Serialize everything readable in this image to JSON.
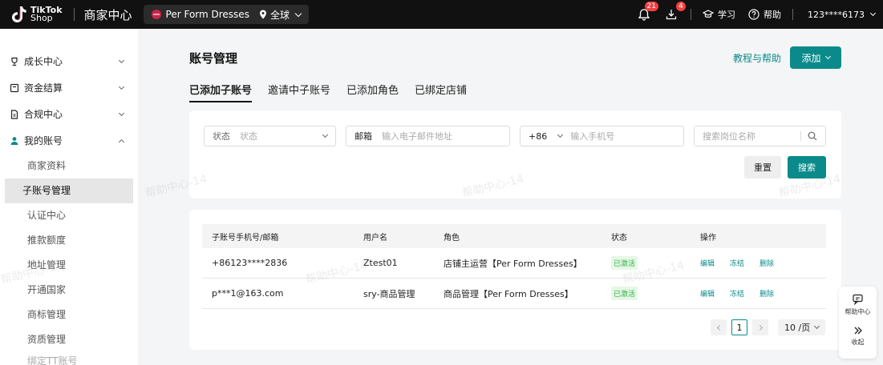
{
  "topbar": {
    "logo_line1": "TikTok",
    "logo_line2": "Shop",
    "title": "商家中心",
    "shop_name": "Per Form Dresses",
    "region": "全球",
    "notif_count": "21",
    "download_count": "4",
    "learn": "学习",
    "help": "帮助",
    "account": "123****6173"
  },
  "sidebar": {
    "groups": [
      {
        "label": "成长中心",
        "icon": "trophy-icon",
        "expanded": false
      },
      {
        "label": "资金结算",
        "icon": "wallet-icon",
        "expanded": false
      },
      {
        "label": "合规中心",
        "icon": "document-icon",
        "expanded": false
      },
      {
        "label": "我的账号",
        "icon": "user-icon",
        "expanded": true
      }
    ],
    "items": [
      {
        "label": "商家资料",
        "active": false
      },
      {
        "label": "子账号管理",
        "active": true
      },
      {
        "label": "认证中心",
        "active": false
      },
      {
        "label": "推款额度",
        "active": false
      },
      {
        "label": "地址管理",
        "active": false
      },
      {
        "label": "开通国家",
        "active": false
      },
      {
        "label": "商标管理",
        "active": false
      },
      {
        "label": "资质管理",
        "active": false
      },
      {
        "label": "绑定TT账号",
        "active": false
      }
    ]
  },
  "main": {
    "title": "账号管理",
    "help_link": "教程与帮助",
    "add_label": "添加",
    "tabs": [
      {
        "label": "已添加子账号",
        "active": true
      },
      {
        "label": "邀请中子账号",
        "active": false
      },
      {
        "label": "已添加角色",
        "active": false
      },
      {
        "label": "已绑定店铺",
        "active": false
      }
    ]
  },
  "filters": {
    "status_label": "状态",
    "status_placeholder": "状态",
    "email_label": "邮箱",
    "email_placeholder": "输入电子邮件地址",
    "phone_code": "+86",
    "phone_placeholder": "输入手机号",
    "role_placeholder": "搜索岗位名称",
    "reset_label": "重置",
    "search_label": "搜索"
  },
  "table": {
    "columns": [
      "子账号手机号/邮箱",
      "用户名",
      "角色",
      "状态",
      "操作"
    ],
    "rows": [
      {
        "account": "+86123****2836",
        "username": "Ztest01",
        "role": "店铺主运营【Per Form Dresses】",
        "status": "已激活"
      },
      {
        "account": "p***1@163.com",
        "username": "sry-商品管理",
        "role": "商品管理【Per Form Dresses】",
        "status": "已激活"
      }
    ],
    "actions": {
      "edit": "编辑",
      "freeze": "冻结",
      "delete": "删除"
    }
  },
  "pager": {
    "current_page": "1",
    "page_size": "10 /页"
  },
  "float_help": {
    "help_center": "帮助中心",
    "collapse": "收起"
  },
  "watermark": "帮助中心-14",
  "colors": {
    "accent": "#0a8a8a",
    "topbar": "#111111",
    "badge": "#f53f3f",
    "status_active": "#2fb344"
  }
}
